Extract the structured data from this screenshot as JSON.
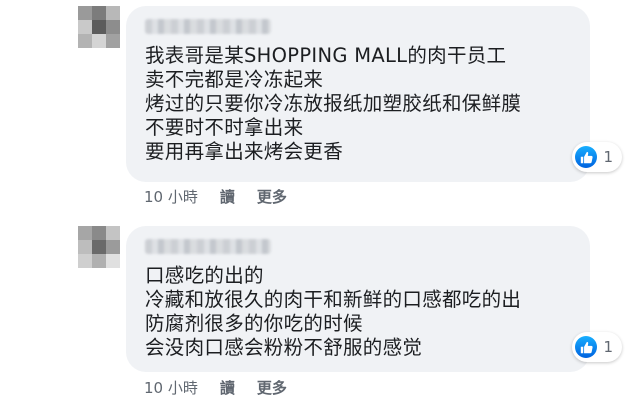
{
  "comments": [
    {
      "lines": [
        "我表哥是某SHOPPING MALL的肉干员工",
        "卖不完都是冷冻起来",
        "烤过的只要你冷冻放报纸加塑胶纸和保鲜膜",
        "不要时不时拿出来",
        "要用再拿出来烤会更香"
      ],
      "reaction_count": "1",
      "reaction_icon": "thumbs-up-icon",
      "time": "10 小時",
      "reply_label": "讀",
      "more_label": "更多"
    },
    {
      "lines": [
        "口感吃的出的",
        "冷藏和放很久的肉干和新鲜的口感都吃的出",
        "防腐剂很多的你吃的时候",
        "会没肉口感会粉粉不舒服的感觉"
      ],
      "reaction_count": "1",
      "reaction_icon": "thumbs-up-icon",
      "time": "10 小時",
      "reply_label": "讀",
      "more_label": "更多"
    }
  ],
  "colors": {
    "bubble_bg": "#f0f2f5",
    "text": "#1c1e21",
    "meta_text": "#606770",
    "like_blue": "#1877f2"
  }
}
